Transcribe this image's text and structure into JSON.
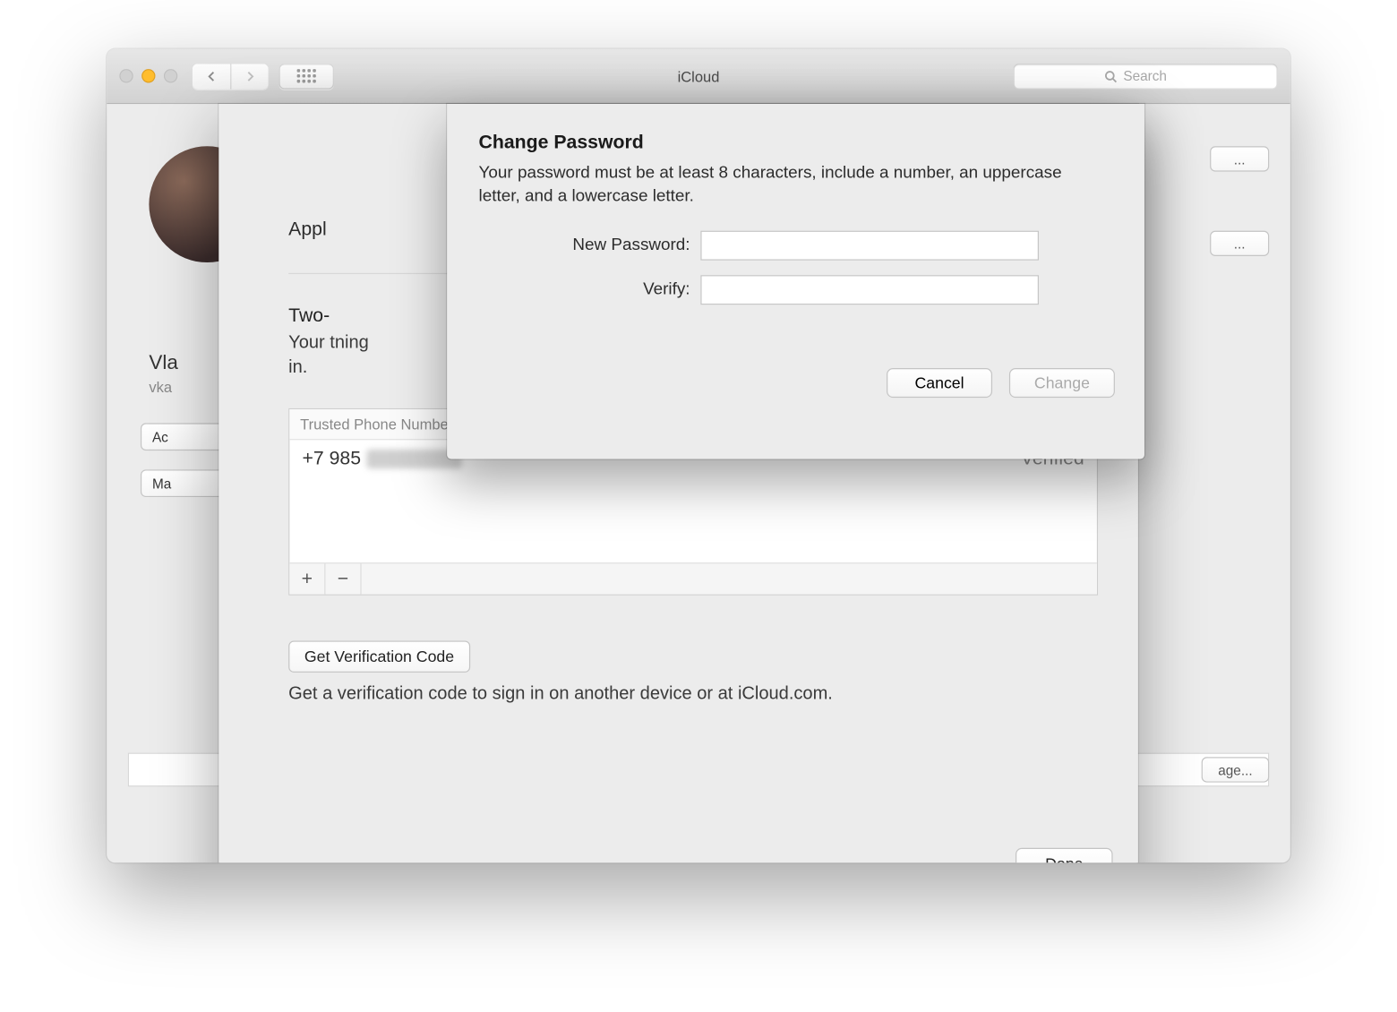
{
  "window": {
    "title": "iCloud"
  },
  "search": {
    "placeholder": "Search"
  },
  "user": {
    "name_visible": "Vla",
    "sub_visible": "vka"
  },
  "side_buttons": {
    "b1": "Ac",
    "b2": "Ma"
  },
  "right_stubs": {
    "s1": "...",
    "s2": "...",
    "s3": "age..."
  },
  "security_sheet": {
    "apple_row_visible": "Appl",
    "two_factor_label_visible": "Two-",
    "two_factor_desc_line1": "Your t",
    "two_factor_desc_suffix": "ning",
    "two_factor_desc_line2": "in.",
    "phones_header": "Trusted Phone Numbers",
    "phone_prefix": "+7 985",
    "phone_status": "Verified",
    "get_code_btn": "Get Verification Code",
    "get_code_desc": "Get a verification code to sign in on another device or at iCloud.com.",
    "done": "Done"
  },
  "pw_sheet": {
    "title": "Change Password",
    "desc": "Your password must be at least 8 characters, include a number, an uppercase letter, and a lowercase letter.",
    "new_label": "New Password:",
    "verify_label": "Verify:",
    "cancel": "Cancel",
    "change": "Change"
  }
}
